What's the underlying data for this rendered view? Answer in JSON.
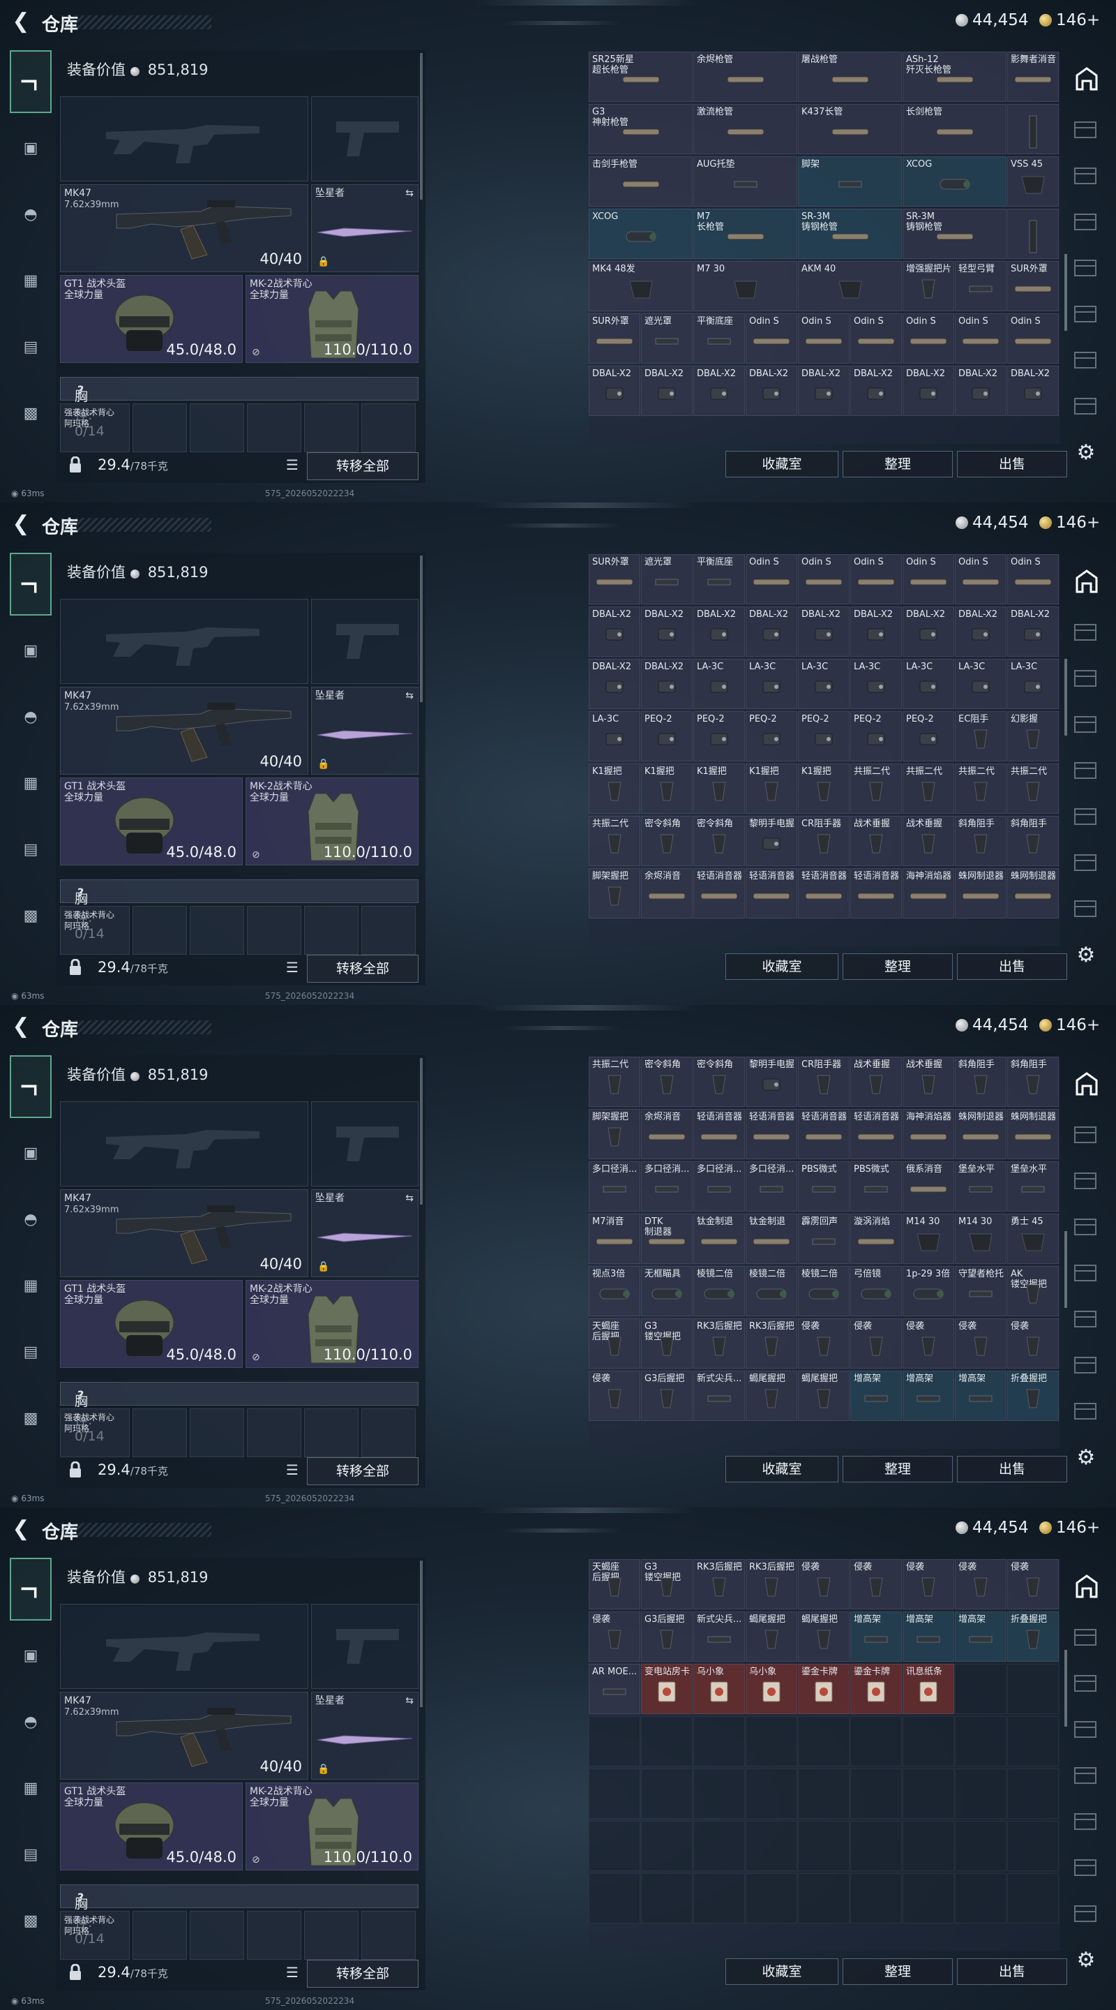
{
  "header": {
    "back_icon": "chevron-left-icon",
    "title": "仓库",
    "silver": "44,454",
    "gold": "146+"
  },
  "left_tabs": [
    "weapon-icon",
    "armor-icon",
    "helmet-icon",
    "backpack-icon",
    "chest-rig-icon",
    "case-icon"
  ],
  "equipment": {
    "value_label": "装备价值",
    "value": "851,819",
    "primary": {
      "name": "MK47",
      "caliber": "7.62x39mm",
      "ammo": "40/40"
    },
    "melee": {
      "name": "坠星者"
    },
    "helmet": {
      "name": "GT1 战术头盔",
      "sub": "全球力量",
      "dur": "45.0/48.0"
    },
    "armor": {
      "name": "MK-2战术背心",
      "sub": "全球力量",
      "dur": "110.0/110.0"
    },
    "chest": {
      "label": "胸挂: 0/14",
      "help": "?",
      "item": "强袭战术背心\n阿玛格"
    },
    "weight": "29.4",
    "weight_max": "/78千克",
    "transfer": "转移全部"
  },
  "footer": {
    "collect": "收藏室",
    "sort": "整理",
    "sell": "出售",
    "ping": "63ms",
    "version": "575_2026052022234"
  },
  "frames": [
    {
      "rows": [
        [
          [
            "SR25新星\n超长枪管",
            ""
          ],
          [
            "余烬枪管",
            ""
          ],
          [
            "屠战枪管",
            ""
          ],
          [
            "ASh-12\n歼灭长枪管",
            ""
          ],
          [
            "影舞者消音",
            ""
          ]
        ],
        [
          [
            "G3\n神射枪管",
            ""
          ],
          [
            "激流枪管",
            ""
          ],
          [
            "K437长管",
            ""
          ],
          [
            "长剑枪管",
            ""
          ],
          [
            "",
            ""
          ]
        ],
        [
          [
            "击剑手枪管",
            ""
          ],
          [
            "AUG托垫",
            ""
          ],
          [
            "脚架",
            "teal"
          ],
          [
            "XCOG",
            "teal"
          ],
          [
            "VSS 45",
            ""
          ]
        ],
        [
          [
            "XCOG",
            "teal"
          ],
          [
            "M7\n长枪管",
            "teal"
          ],
          [
            "SR-3M\n铸钢枪管",
            "teal"
          ],
          [
            "SR-3M\n铸钢枪管",
            ""
          ],
          [
            "",
            ""
          ]
        ],
        [
          [
            "MK4 48发",
            ""
          ],
          [
            "M7 30",
            ""
          ],
          [
            "AKM 40",
            ""
          ],
          [
            "增强握把片",
            ""
          ],
          [
            "轻型弓臂",
            ""
          ],
          [
            "SUR外罩",
            ""
          ]
        ],
        [
          [
            "SUR外罩",
            ""
          ],
          [
            "遮光罩",
            ""
          ],
          [
            "平衡底座",
            ""
          ],
          [
            "Odin S",
            ""
          ],
          [
            "Odin S",
            ""
          ],
          [
            "Odin S",
            ""
          ],
          [
            "Odin S",
            ""
          ],
          [
            "Odin S",
            ""
          ],
          [
            "Odin S",
            ""
          ]
        ],
        [
          [
            "DBAL-X2",
            ""
          ],
          [
            "DBAL-X2",
            ""
          ],
          [
            "DBAL-X2",
            ""
          ],
          [
            "DBAL-X2",
            ""
          ],
          [
            "DBAL-X2",
            ""
          ],
          [
            "DBAL-X2",
            ""
          ],
          [
            "DBAL-X2",
            ""
          ],
          [
            "DBAL-X2",
            ""
          ],
          [
            "DBAL-X2",
            ""
          ]
        ]
      ]
    },
    {
      "rows": [
        [
          [
            "SUR外罩",
            ""
          ],
          [
            "遮光罩",
            ""
          ],
          [
            "平衡底座",
            ""
          ],
          [
            "Odin S",
            ""
          ],
          [
            "Odin S",
            ""
          ],
          [
            "Odin S",
            ""
          ],
          [
            "Odin S",
            ""
          ],
          [
            "Odin S",
            ""
          ],
          [
            "Odin S",
            ""
          ]
        ],
        [
          [
            "DBAL-X2",
            ""
          ],
          [
            "DBAL-X2",
            ""
          ],
          [
            "DBAL-X2",
            ""
          ],
          [
            "DBAL-X2",
            ""
          ],
          [
            "DBAL-X2",
            ""
          ],
          [
            "DBAL-X2",
            ""
          ],
          [
            "DBAL-X2",
            ""
          ],
          [
            "DBAL-X2",
            ""
          ],
          [
            "DBAL-X2",
            ""
          ]
        ],
        [
          [
            "DBAL-X2",
            ""
          ],
          [
            "DBAL-X2",
            ""
          ],
          [
            "LA-3C",
            ""
          ],
          [
            "LA-3C",
            ""
          ],
          [
            "LA-3C",
            ""
          ],
          [
            "LA-3C",
            ""
          ],
          [
            "LA-3C",
            ""
          ],
          [
            "LA-3C",
            ""
          ],
          [
            "LA-3C",
            ""
          ]
        ],
        [
          [
            "LA-3C",
            ""
          ],
          [
            "PEQ-2",
            ""
          ],
          [
            "PEQ-2",
            ""
          ],
          [
            "PEQ-2",
            ""
          ],
          [
            "PEQ-2",
            ""
          ],
          [
            "PEQ-2",
            ""
          ],
          [
            "PEQ-2",
            ""
          ],
          [
            "EC阻手",
            ""
          ],
          [
            "幻影握",
            ""
          ]
        ],
        [
          [
            "K1握把",
            ""
          ],
          [
            "K1握把",
            ""
          ],
          [
            "K1握把",
            ""
          ],
          [
            "K1握把",
            ""
          ],
          [
            "K1握把",
            ""
          ],
          [
            "共振二代",
            ""
          ],
          [
            "共振二代",
            ""
          ],
          [
            "共振二代",
            ""
          ],
          [
            "共振二代",
            ""
          ]
        ],
        [
          [
            "共振二代",
            ""
          ],
          [
            "密令斜角",
            ""
          ],
          [
            "密令斜角",
            ""
          ],
          [
            "黎明手电握",
            ""
          ],
          [
            "CR阻手器",
            ""
          ],
          [
            "战术垂握",
            ""
          ],
          [
            "战术垂握",
            ""
          ],
          [
            "斜角阻手",
            ""
          ],
          [
            "斜角阻手",
            ""
          ]
        ],
        [
          [
            "脚架握把",
            ""
          ],
          [
            "余烬消音",
            ""
          ],
          [
            "轻语消音器",
            ""
          ],
          [
            "轻语消音器",
            ""
          ],
          [
            "轻语消音器",
            ""
          ],
          [
            "轻语消音器",
            ""
          ],
          [
            "海神消焰器",
            ""
          ],
          [
            "蛛网制退器",
            ""
          ],
          [
            "蛛网制退器",
            ""
          ]
        ]
      ]
    },
    {
      "rows": [
        [
          [
            "共振二代",
            ""
          ],
          [
            "密令斜角",
            ""
          ],
          [
            "密令斜角",
            ""
          ],
          [
            "黎明手电握",
            ""
          ],
          [
            "CR阻手器",
            ""
          ],
          [
            "战术垂握",
            ""
          ],
          [
            "战术垂握",
            ""
          ],
          [
            "斜角阻手",
            ""
          ],
          [
            "斜角阻手",
            ""
          ]
        ],
        [
          [
            "脚架握把",
            ""
          ],
          [
            "余烬消音",
            ""
          ],
          [
            "轻语消音器",
            ""
          ],
          [
            "轻语消音器",
            ""
          ],
          [
            "轻语消音器",
            ""
          ],
          [
            "轻语消音器",
            ""
          ],
          [
            "海神消焰器",
            ""
          ],
          [
            "蛛网制退器",
            ""
          ],
          [
            "蛛网制退器",
            ""
          ]
        ],
        [
          [
            "多口径消...",
            ""
          ],
          [
            "多口径消...",
            ""
          ],
          [
            "多口径消...",
            ""
          ],
          [
            "多口径消...",
            ""
          ],
          [
            "PBS微式",
            ""
          ],
          [
            "PBS微式",
            ""
          ],
          [
            "俄系消音",
            ""
          ],
          [
            "堡垒水平",
            ""
          ],
          [
            "堡垒水平",
            ""
          ]
        ],
        [
          [
            "M7消音",
            ""
          ],
          [
            "DTK\n制退器",
            ""
          ],
          [
            "钛金制退",
            ""
          ],
          [
            "钛金制退",
            ""
          ],
          [
            "霹雳回声",
            ""
          ],
          [
            "漩涡消焰",
            ""
          ],
          [
            "M14 30",
            ""
          ],
          [
            "M14 30",
            ""
          ],
          [
            "勇士 45",
            ""
          ]
        ],
        [
          [
            "视点3倍",
            ""
          ],
          [
            "无框瞄具",
            ""
          ],
          [
            "棱镜二倍",
            ""
          ],
          [
            "棱镜二倍",
            ""
          ],
          [
            "棱镜二倍",
            ""
          ],
          [
            "弓倍镜",
            ""
          ],
          [
            "1p-29 3倍",
            ""
          ],
          [
            "守望者枪托",
            ""
          ],
          [
            "AK\n镂空握把",
            ""
          ]
        ],
        [
          [
            "天蝎座\n后握把",
            ""
          ],
          [
            "G3\n镂空握把",
            ""
          ],
          [
            "RK3后握把",
            ""
          ],
          [
            "RK3后握把",
            ""
          ],
          [
            "侵袭",
            ""
          ],
          [
            "侵袭",
            ""
          ],
          [
            "侵袭",
            ""
          ],
          [
            "侵袭",
            ""
          ],
          [
            "侵袭",
            ""
          ]
        ],
        [
          [
            "侵袭",
            ""
          ],
          [
            "G3后握把",
            ""
          ],
          [
            "新式尖兵...",
            ""
          ],
          [
            "蝎尾握把",
            ""
          ],
          [
            "蝎尾握把",
            ""
          ],
          [
            "增高架",
            "teal"
          ],
          [
            "增高架",
            "teal"
          ],
          [
            "增高架",
            "teal"
          ],
          [
            "折叠握把",
            "teal"
          ]
        ]
      ]
    },
    {
      "rows": [
        [
          [
            "天蝎座\n后握把",
            ""
          ],
          [
            "G3\n镂空握把",
            ""
          ],
          [
            "RK3后握把",
            ""
          ],
          [
            "RK3后握把",
            ""
          ],
          [
            "侵袭",
            ""
          ],
          [
            "侵袭",
            ""
          ],
          [
            "侵袭",
            ""
          ],
          [
            "侵袭",
            ""
          ],
          [
            "侵袭",
            ""
          ]
        ],
        [
          [
            "侵袭",
            ""
          ],
          [
            "G3后握把",
            ""
          ],
          [
            "新式尖兵...",
            ""
          ],
          [
            "蝎尾握把",
            ""
          ],
          [
            "蝎尾握把",
            ""
          ],
          [
            "增高架",
            "teal"
          ],
          [
            "增高架",
            "teal"
          ],
          [
            "增高架",
            "teal"
          ],
          [
            "折叠握把",
            "teal"
          ]
        ],
        [
          [
            "AR MOE...",
            ""
          ],
          [
            "变电站房卡",
            "red"
          ],
          [
            "乌小象",
            "red"
          ],
          [
            "乌小象",
            "red"
          ],
          [
            "鎏金卡牌",
            "red"
          ],
          [
            "鎏金卡牌",
            "red"
          ],
          [
            "讯息纸条",
            "red"
          ]
        ]
      ]
    }
  ]
}
